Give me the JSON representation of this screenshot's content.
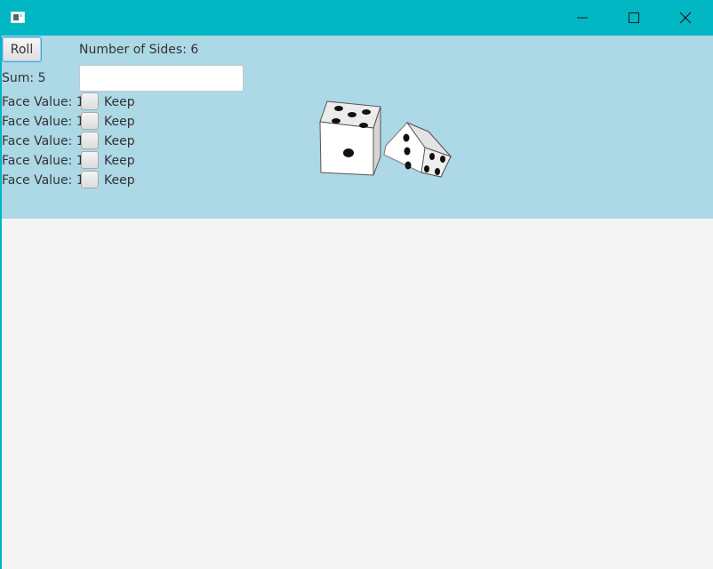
{
  "window": {
    "title": "",
    "icon": "app-window-icon",
    "controls": [
      "minimize-icon",
      "maximize-icon",
      "close-icon"
    ]
  },
  "controls": {
    "roll_label": "Roll",
    "sides_label": "Number of Sides: 6",
    "sum_label": "Sum: 5",
    "sides_input_value": ""
  },
  "faces": [
    {
      "label": "Face Value: 1",
      "keep": "Keep",
      "checked": false
    },
    {
      "label": "Face Value: 1",
      "keep": "Keep",
      "checked": false
    },
    {
      "label": "Face Value: 1",
      "keep": "Keep",
      "checked": false
    },
    {
      "label": "Face Value: 1",
      "keep": "Keep",
      "checked": false
    },
    {
      "label": "Face Value: 1",
      "keep": "Keep",
      "checked": false
    }
  ],
  "dice_image": {
    "icon": "dice-image",
    "dice": [
      {
        "top_face": 5,
        "front_face": 1
      },
      {
        "front_face": 3,
        "side_face": 4
      }
    ]
  },
  "colors": {
    "titlebar": "#00b7c3",
    "panel": "#add8e6",
    "background": "#f4f4f4"
  }
}
